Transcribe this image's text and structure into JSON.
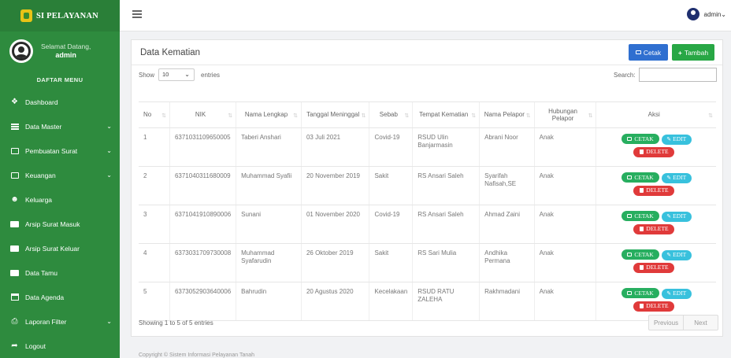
{
  "app": {
    "title": "SI PELAYANAN"
  },
  "sidebar": {
    "welcome": "Selamat Datang,",
    "username": "admin",
    "menu_header": "DAFTAR MENU",
    "items": [
      {
        "label": "Dashboard",
        "icon": "home-icon"
      },
      {
        "label": "Data Master",
        "icon": "table-icon"
      },
      {
        "label": "Pembuatan Surat",
        "icon": "document-icon"
      },
      {
        "label": "Keuangan",
        "icon": "money-icon"
      },
      {
        "label": "Keluarga",
        "icon": "users-icon"
      },
      {
        "label": "Arsip Surat Masuk",
        "icon": "envelope-icon"
      },
      {
        "label": "Arsip Surat Keluar",
        "icon": "envelope-icon"
      },
      {
        "label": "Data Tamu",
        "icon": "guest-icon"
      },
      {
        "label": "Data Agenda",
        "icon": "calendar-icon"
      },
      {
        "label": "Laporan Filter",
        "icon": "print-icon"
      },
      {
        "label": "Logout",
        "icon": "logout-icon"
      }
    ]
  },
  "topbar": {
    "user": "admin"
  },
  "card": {
    "title": "Data Kematian",
    "cetak_label": "Cetak",
    "tambah_label": "Tambah"
  },
  "controls": {
    "show_label": "Show",
    "entries_value": "10",
    "entries_label": "entries",
    "search_label": "Search:",
    "search_value": ""
  },
  "table": {
    "headers": [
      "No",
      "NIK",
      "Nama Lengkap",
      "Tanggal Meninggal",
      "Sebab",
      "Tempat Kematian",
      "Nama Pelapor",
      "Hubungan Pelapor",
      "Aksi"
    ],
    "rows": [
      [
        "1",
        "6371031109650005",
        "Taberi Anshari",
        "03 Juli 2021",
        "Covid-19",
        "RSUD Ulin Banjarmasin",
        "Abrani Noor",
        "Anak"
      ],
      [
        "2",
        "6371040311680009",
        "Muhammad Syafii",
        "20 November 2019",
        "Sakit",
        "RS Ansari Saleh",
        "Syarifah Nafisah,SE",
        "Anak"
      ],
      [
        "3",
        "6371041910890006",
        "Sunani",
        "01 November 2020",
        "Covid-19",
        "RS Ansari Saleh",
        "Ahmad Zaini",
        "Anak"
      ],
      [
        "4",
        "6373031709730008",
        "Muhammad Syafarudin",
        "26 Oktober 2019",
        "Sakit",
        "RS Sari Mulia",
        "Andhika Permana",
        "Anak"
      ],
      [
        "5",
        "6373052903640006",
        "Bahrudin",
        "20 Agustus 2020",
        "Kecelakaan",
        "RSUD RATU ZALEHA",
        "Rakhmadani",
        "Anak"
      ]
    ],
    "actions": {
      "cetak": "CETAK",
      "edit": "EDIT",
      "delete": "DELETE"
    }
  },
  "footer": {
    "info": "Showing 1 to 5 of 5 entries",
    "previous": "Previous",
    "next": "Next",
    "copyright": "Copyright © Sistem Informasi Pelayanan Tanah"
  }
}
